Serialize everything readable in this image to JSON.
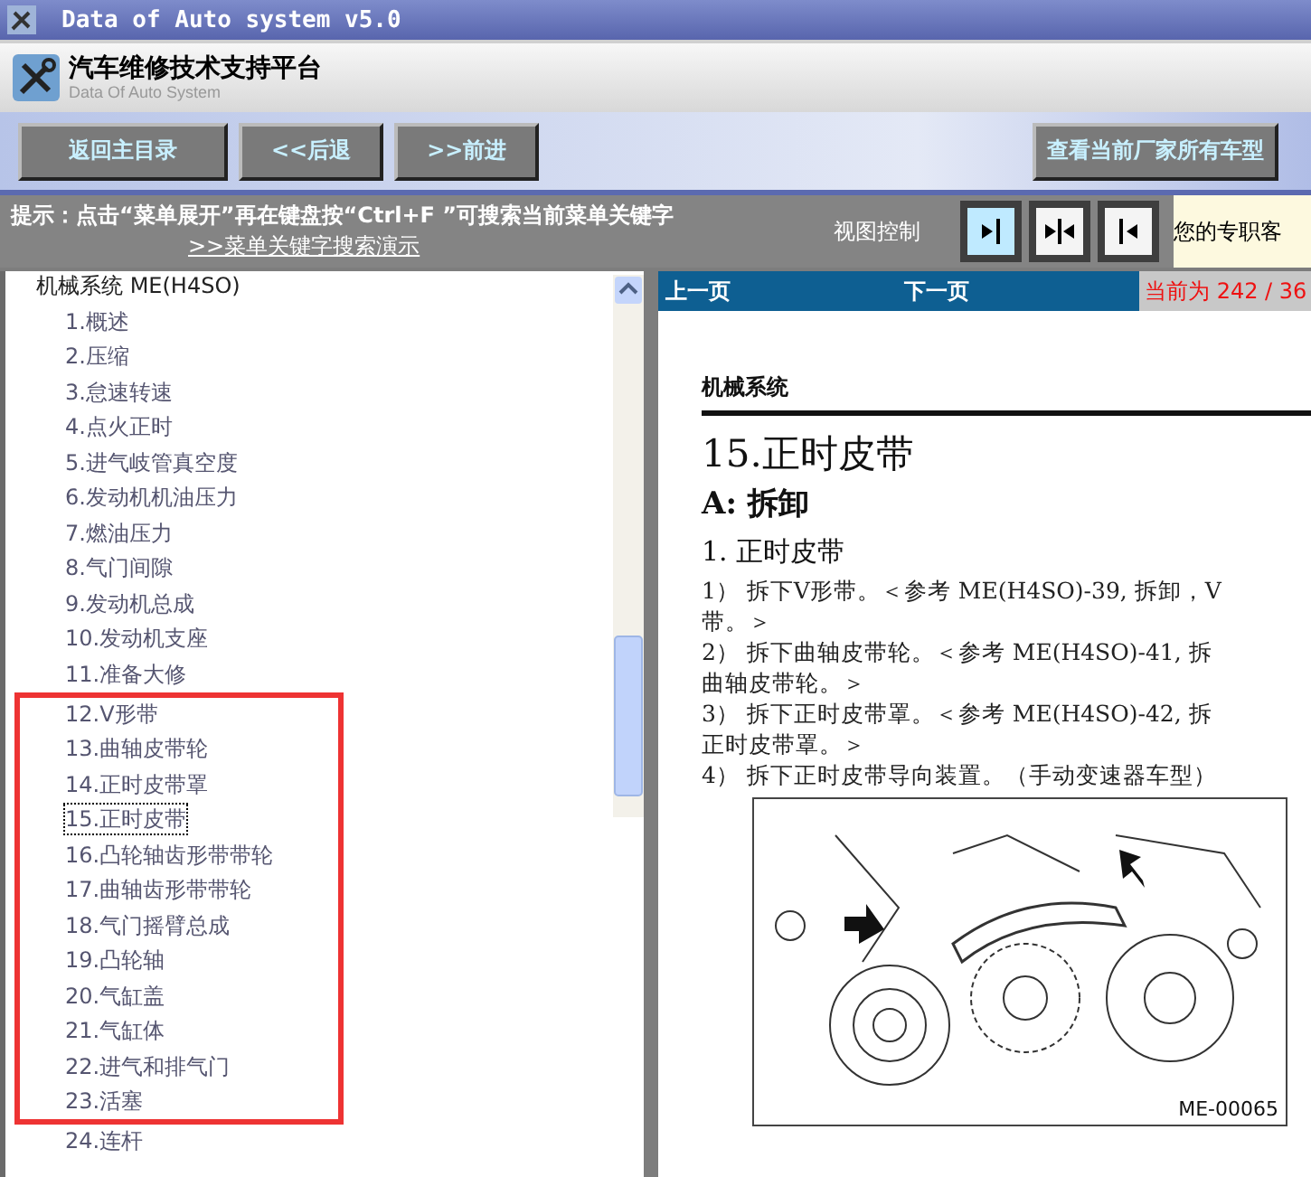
{
  "window": {
    "title": "Data of Auto system v5.0"
  },
  "header": {
    "title": "汽车维修技术支持平台",
    "subtitle": "Data Of Auto System"
  },
  "toolbar": {
    "buttons": [
      "返回主目录",
      "<<后退",
      ">>前进"
    ],
    "right_button": "查看当前厂家所有车型"
  },
  "hint": {
    "text": "提示：点击“菜单展开”再在键盘按“Ctrl+F ”可搜索当前菜单关键字",
    "link": ">>菜单关键字搜索演示",
    "view_label": "视图控制",
    "view_buttons": [
      {
        "kind": "right",
        "selected": true
      },
      {
        "kind": "both",
        "selected": false
      },
      {
        "kind": "left",
        "selected": false
      }
    ],
    "notice": "您的专职客"
  },
  "tree": {
    "root": "机械系统 ME(H4SO)",
    "children": [
      {
        "label": "1.概述",
        "selected": false,
        "highlighted": false
      },
      {
        "label": "2.压缩",
        "selected": false,
        "highlighted": false
      },
      {
        "label": "3.怠速转速",
        "selected": false,
        "highlighted": false
      },
      {
        "label": "4.点火正时",
        "selected": false,
        "highlighted": false
      },
      {
        "label": "5.进气岐管真空度",
        "selected": false,
        "highlighted": false
      },
      {
        "label": "6.发动机机油压力",
        "selected": false,
        "highlighted": false
      },
      {
        "label": "7.燃油压力",
        "selected": false,
        "highlighted": false
      },
      {
        "label": "8.气门间隙",
        "selected": false,
        "highlighted": false
      },
      {
        "label": "9.发动机总成",
        "selected": false,
        "highlighted": false
      },
      {
        "label": "10.发动机支座",
        "selected": false,
        "highlighted": false
      },
      {
        "label": "11.准备大修",
        "selected": false,
        "highlighted": false
      },
      {
        "label": "12.V形带",
        "selected": false,
        "highlighted": true
      },
      {
        "label": "13.曲轴皮带轮",
        "selected": false,
        "highlighted": true
      },
      {
        "label": "14.正时皮带罩",
        "selected": false,
        "highlighted": true
      },
      {
        "label": "15.正时皮带",
        "selected": true,
        "highlighted": true
      },
      {
        "label": "16.凸轮轴齿形带带轮",
        "selected": false,
        "highlighted": true
      },
      {
        "label": "17.曲轴齿形带带轮",
        "selected": false,
        "highlighted": true
      },
      {
        "label": "18.气门摇臂总成",
        "selected": false,
        "highlighted": true
      },
      {
        "label": "19.凸轮轴",
        "selected": false,
        "highlighted": true
      },
      {
        "label": "20.气缸盖",
        "selected": false,
        "highlighted": true
      },
      {
        "label": "21.气缸体",
        "selected": false,
        "highlighted": true
      },
      {
        "label": "22.进气和排气门",
        "selected": false,
        "highlighted": true
      },
      {
        "label": "23.活塞",
        "selected": false,
        "highlighted": true
      },
      {
        "label": "24.连杆",
        "selected": false,
        "highlighted": false
      }
    ]
  },
  "document": {
    "prev": "上一页",
    "next": "下一页",
    "page": "当前为 242 / 36",
    "section": "机械系统",
    "title": "15.正时皮带",
    "subtitle": "A: 拆卸",
    "heading": "1. 正时皮带",
    "lines": [
      "1） 拆下V形带。＜参考 ME(H4SO)-39, 拆卸，V",
      "带。＞",
      "2） 拆下曲轴皮带轮。＜参考 ME(H4SO)-41, 拆",
      "曲轴皮带轮。＞",
      "3） 拆下正时皮带罩。＜参考 ME(H4SO)-42, 拆",
      "正时皮带罩。＞",
      "4） 拆下正时皮带导向装置。（手动变速器车型）"
    ],
    "figure_label": "ME-00065"
  }
}
